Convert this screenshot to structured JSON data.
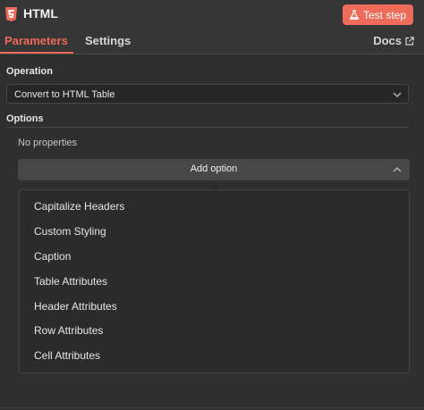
{
  "header": {
    "icon": "html5-icon",
    "title": "HTML",
    "test_button_icon": "flask-icon",
    "test_button_label": "Test step",
    "accent_color": "#ee6b5a"
  },
  "tabs": {
    "parameters": "Parameters",
    "settings": "Settings",
    "docs": "Docs",
    "docs_icon": "external-link-icon",
    "active": "Parameters"
  },
  "operation": {
    "label": "Operation",
    "value": "Convert to HTML Table",
    "chevron_icon": "chevron-down-icon"
  },
  "options": {
    "label": "Options",
    "empty_text": "No properties",
    "add_button_label": "Add option",
    "chevron_icon": "chevron-up-icon",
    "items": [
      "Capitalize Headers",
      "Custom Styling",
      "Caption",
      "Table Attributes",
      "Header Attributes",
      "Row Attributes",
      "Cell Attributes"
    ]
  }
}
